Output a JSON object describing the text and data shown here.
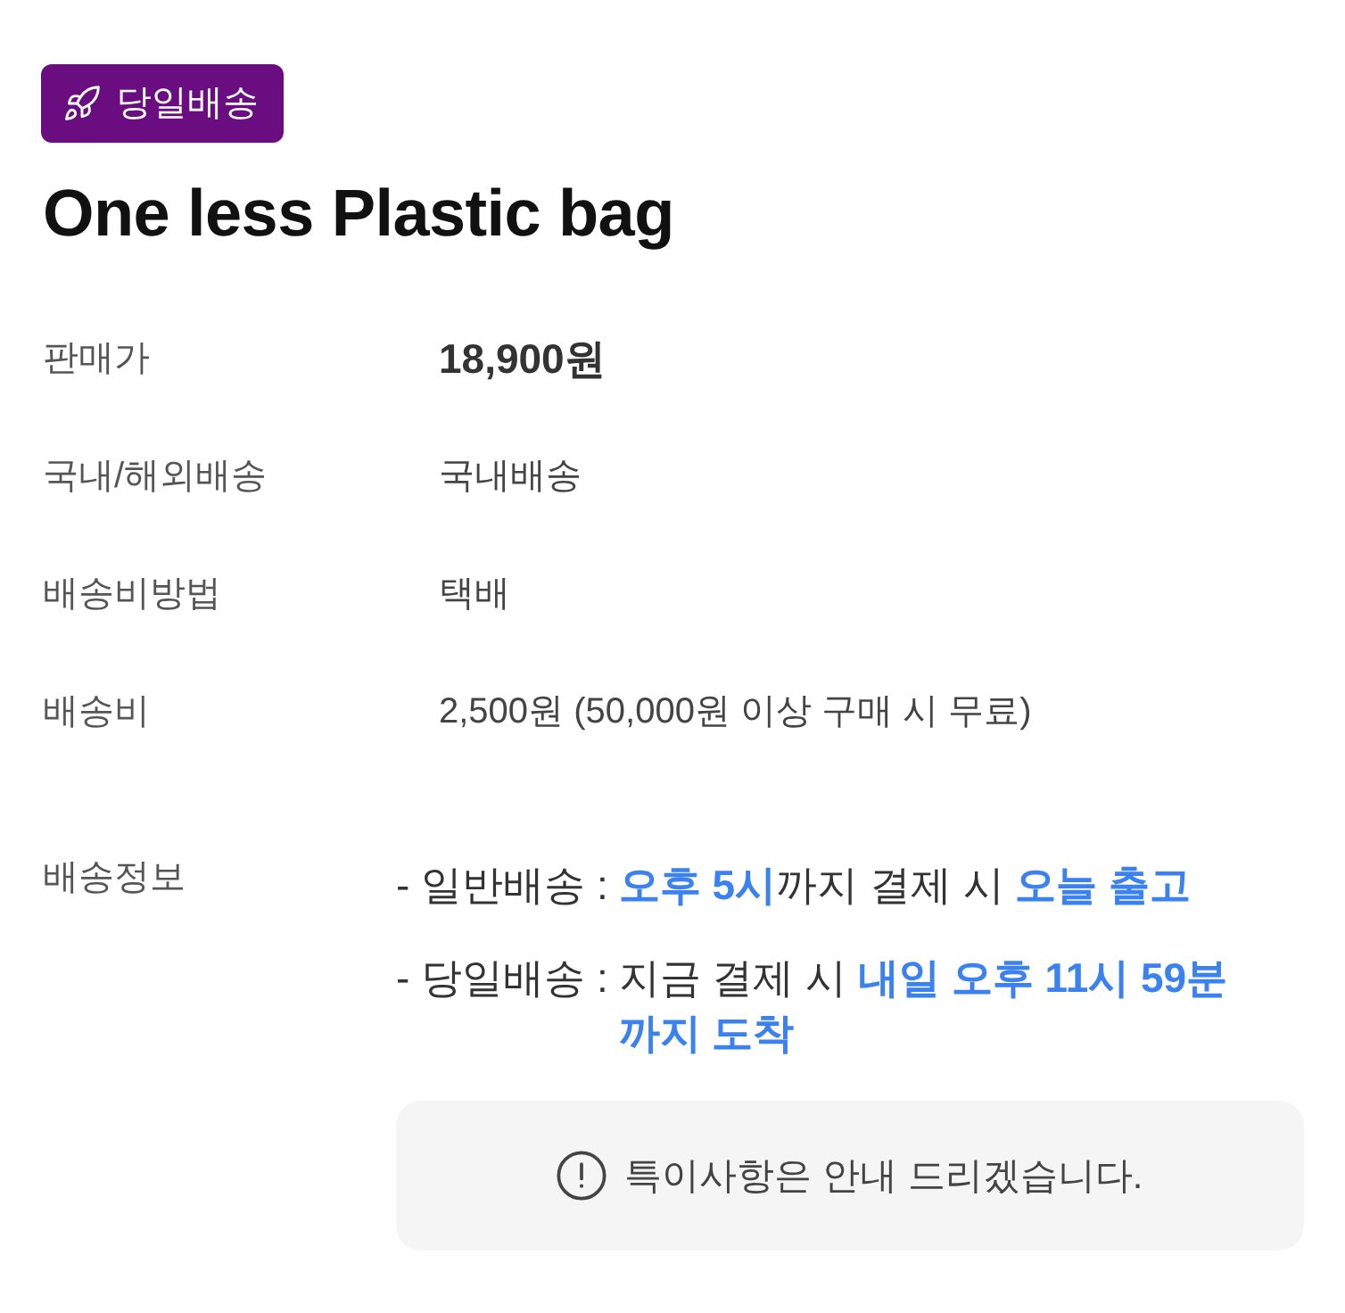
{
  "badge": {
    "label": "당일배송"
  },
  "product": {
    "title": "One less Plastic bag"
  },
  "info_rows": [
    {
      "label": "판매가",
      "value": "18,900원",
      "kind": "price"
    },
    {
      "label": "국내/해외배송",
      "value": "국내배송",
      "kind": "plain"
    },
    {
      "label": "배송비방법",
      "value": "택배",
      "kind": "plain"
    },
    {
      "label": "배송비",
      "value": "2,500원 (50,000원 이상 구매 시 무료)",
      "kind": "plain"
    }
  ],
  "delivery_info": {
    "label": "배송정보",
    "lines": [
      {
        "prefix": "- 일반배송 :",
        "text": "**오후 5시**까지 결제 시 **오늘 출고**"
      },
      {
        "prefix": "- 당일배송 :",
        "text": "지금 결제 시 **내일 오후 11시 59분 까지 도착**"
      }
    ]
  },
  "notice": {
    "text": "특이사항은 안내 드리겠습니다."
  }
}
